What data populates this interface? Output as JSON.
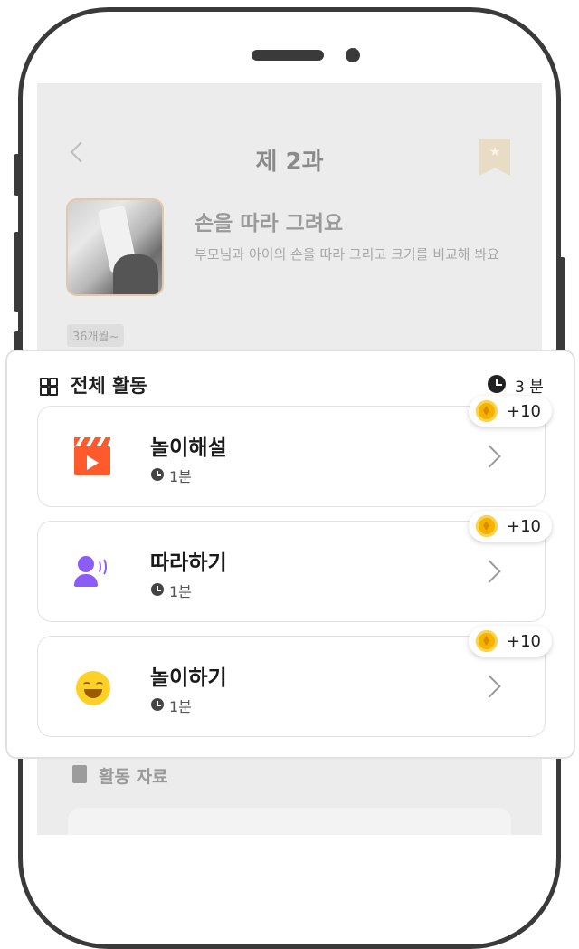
{
  "lesson": {
    "title": "제 2과",
    "activity_title": "손을 따라 그려요",
    "activity_desc": "부모님과 아이의 손을 따라 그리고 크기를 비교해 봐요",
    "age_tag": "36개월~"
  },
  "panel": {
    "title": "전체 활동",
    "total_time": "3 분",
    "items": [
      {
        "name": "놀이해설",
        "duration": "1분",
        "reward": "+10",
        "icon": "clapperboard-icon"
      },
      {
        "name": "따라하기",
        "duration": "1분",
        "reward": "+10",
        "icon": "speaking-person-icon"
      },
      {
        "name": "놀이하기",
        "duration": "1분",
        "reward": "+10",
        "icon": "smile-face-icon"
      }
    ]
  },
  "materials": {
    "title": "활동 자료"
  },
  "colors": {
    "accent_orange": "#ff5a2c",
    "accent_purple": "#8b5cf6",
    "accent_yellow": "#ffd028",
    "coin": "#f2b400"
  }
}
